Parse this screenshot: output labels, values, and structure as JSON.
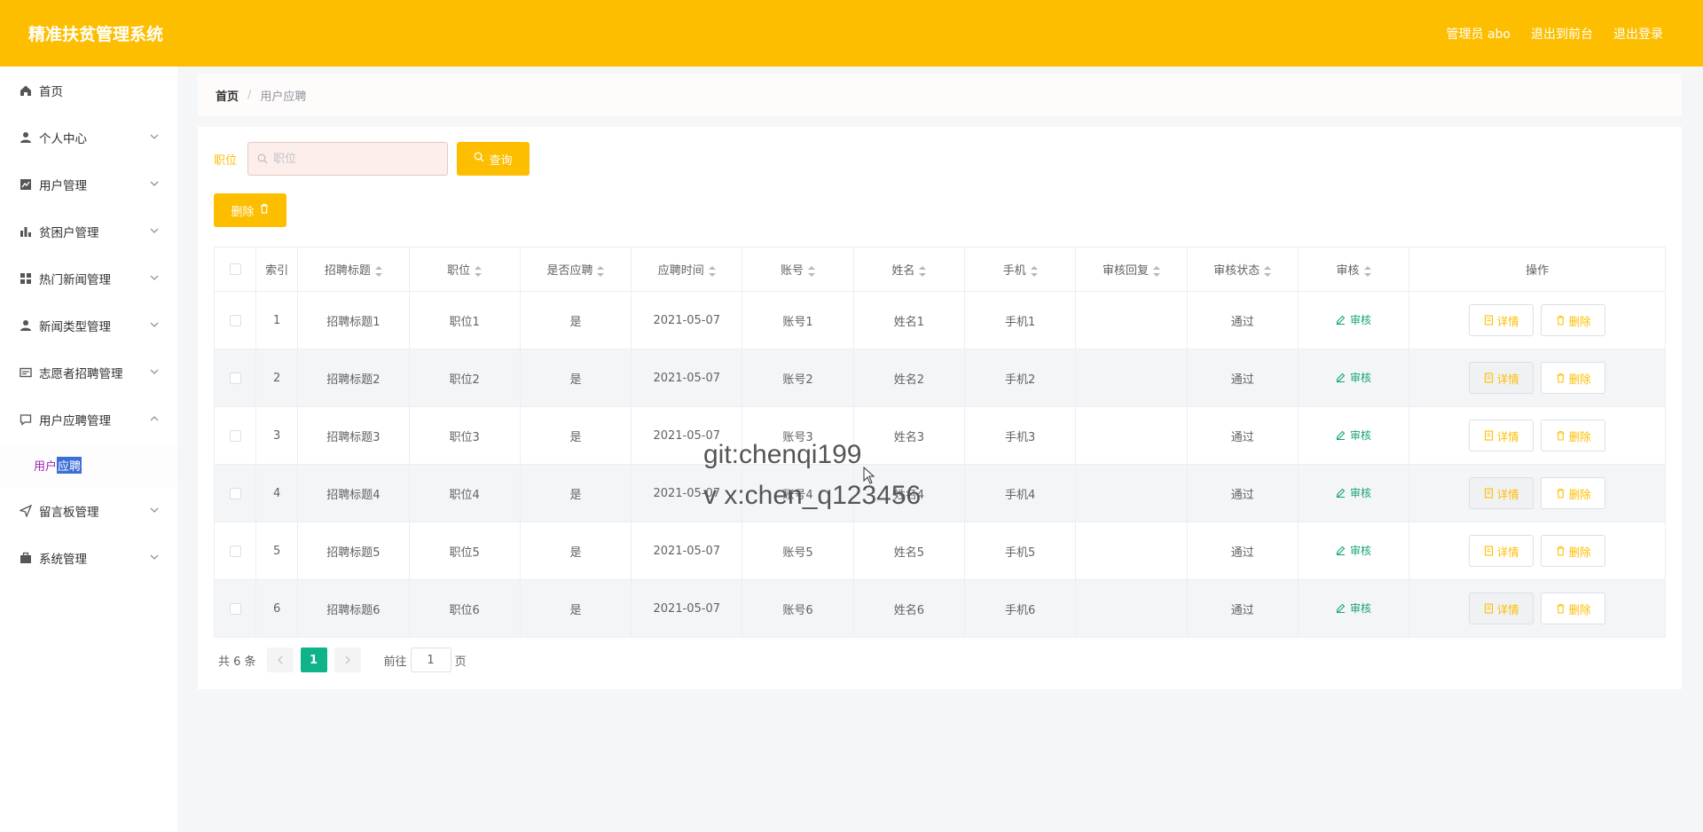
{
  "header": {
    "title": "精准扶贫管理系统",
    "user_label": "管理员 abo",
    "to_front": "退出到前台",
    "logout": "退出登录"
  },
  "sidebar": {
    "items": [
      {
        "label": "首页",
        "icon": "home-icon"
      },
      {
        "label": "个人中心",
        "icon": "user-icon"
      },
      {
        "label": "用户管理",
        "icon": "chart-icon"
      },
      {
        "label": "贫困户管理",
        "icon": "bar-chart-icon"
      },
      {
        "label": "热门新闻管理",
        "icon": "grid-icon"
      },
      {
        "label": "新闻类型管理",
        "icon": "user-icon"
      },
      {
        "label": "志愿者招聘管理",
        "icon": "card-icon"
      },
      {
        "label": "用户应聘管理",
        "icon": "message-icon"
      },
      {
        "label": "留言板管理",
        "icon": "send-icon"
      },
      {
        "label": "系统管理",
        "icon": "suitcase-icon"
      }
    ],
    "submenu_prefix": "用户",
    "submenu_selected": "应聘"
  },
  "breadcrumb": {
    "home": "首页",
    "separator": "/",
    "current": "用户应聘"
  },
  "search": {
    "label": "职位",
    "placeholder": "职位",
    "value": "",
    "query_button": "查询"
  },
  "actions": {
    "delete_button": "删除"
  },
  "table": {
    "columns": [
      "索引",
      "招聘标题",
      "职位",
      "是否应聘",
      "应聘时间",
      "账号",
      "姓名",
      "手机",
      "审核回复",
      "审核状态",
      "审核",
      "操作"
    ],
    "audit_label": "审核",
    "detail_label": "详情",
    "delete_label": "删除",
    "rows": [
      {
        "index": "1",
        "title": "招聘标题1",
        "position": "职位1",
        "applied": "是",
        "time": "2021-05-07",
        "account": "账号1",
        "name": "姓名1",
        "phone": "手机1",
        "reply": "",
        "status": "通过"
      },
      {
        "index": "2",
        "title": "招聘标题2",
        "position": "职位2",
        "applied": "是",
        "time": "2021-05-07",
        "account": "账号2",
        "name": "姓名2",
        "phone": "手机2",
        "reply": "",
        "status": "通过"
      },
      {
        "index": "3",
        "title": "招聘标题3",
        "position": "职位3",
        "applied": "是",
        "time": "2021-05-07",
        "account": "账号3",
        "name": "姓名3",
        "phone": "手机3",
        "reply": "",
        "status": "通过"
      },
      {
        "index": "4",
        "title": "招聘标题4",
        "position": "职位4",
        "applied": "是",
        "time": "2021-05-07",
        "account": "账号4",
        "name": "姓名4",
        "phone": "手机4",
        "reply": "",
        "status": "通过"
      },
      {
        "index": "5",
        "title": "招聘标题5",
        "position": "职位5",
        "applied": "是",
        "time": "2021-05-07",
        "account": "账号5",
        "name": "姓名5",
        "phone": "手机5",
        "reply": "",
        "status": "通过"
      },
      {
        "index": "6",
        "title": "招聘标题6",
        "position": "职位6",
        "applied": "是",
        "time": "2021-05-07",
        "account": "账号6",
        "name": "姓名6",
        "phone": "手机6",
        "reply": "",
        "status": "通过"
      }
    ]
  },
  "pagination": {
    "total": "共 6 条",
    "current_page": "1",
    "goto_label": "前往",
    "goto_value": "1",
    "page_unit": "页"
  },
  "overlay": {
    "line1": "git:chenqi199",
    "line2": "v x:chen_q123456"
  },
  "colors": {
    "brand": "#fdbe00",
    "accent_green": "#0fb38a",
    "submenu_text": "#9c27b0"
  }
}
